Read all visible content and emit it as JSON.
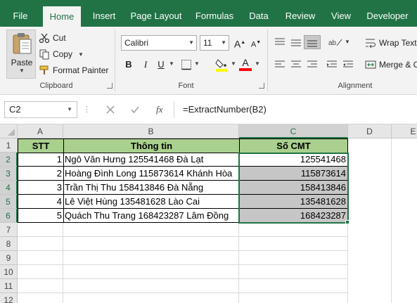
{
  "ribbon_tabs": [
    {
      "label": "File",
      "active": false
    },
    {
      "label": "Home",
      "active": true
    },
    {
      "label": "Insert",
      "active": false
    },
    {
      "label": "Page Layout",
      "active": false
    },
    {
      "label": "Formulas",
      "active": false
    },
    {
      "label": "Data",
      "active": false
    },
    {
      "label": "Review",
      "active": false
    },
    {
      "label": "View",
      "active": false
    },
    {
      "label": "Developer",
      "active": false
    }
  ],
  "clipboard": {
    "paste_label": "Paste",
    "cut_label": "Cut",
    "copy_label": "Copy",
    "format_painter_label": "Format Painter",
    "group_label": "Clipboard"
  },
  "font": {
    "font_name": "Calibri",
    "font_size": "11",
    "bold": "B",
    "italic": "I",
    "underline": "U",
    "grow": "A",
    "shrink": "A",
    "group_label": "Font"
  },
  "alignment": {
    "wrap_text_label": "Wrap Text",
    "merge_label": "Merge & C",
    "group_label": "Alignment"
  },
  "formula_bar": {
    "name_box": "C2",
    "fx": "fx",
    "formula": "=ExtractNumber(B2)"
  },
  "columns": [
    "A",
    "B",
    "C",
    "D",
    "E"
  ],
  "rows": [
    "1",
    "2",
    "3",
    "4",
    "5",
    "6",
    "7",
    "8",
    "9",
    "10",
    "11",
    "12"
  ],
  "table": {
    "headers": [
      "STT",
      "Thông tin",
      "Số CMT"
    ],
    "rows": [
      {
        "stt": "1",
        "info": "Ngô Văn Hưng 125541468 Đà Lạt",
        "cmt": "125541468"
      },
      {
        "stt": "2",
        "info": "Hoàng Đình Long 115873614 Khánh Hòa",
        "cmt": "115873614"
      },
      {
        "stt": "3",
        "info": "Trần Thị Thu 158413846 Đà Nẵng",
        "cmt": "158413846"
      },
      {
        "stt": "4",
        "info": "Lê Việt Hùng 135481628 Lào Cai",
        "cmt": "135481628"
      },
      {
        "stt": "5",
        "info": "Quách Thu Trang 168423287 Lâm Đồng",
        "cmt": "168423287"
      }
    ]
  },
  "colors": {
    "accent": "#217346",
    "header_fill": "#a9d08e",
    "selection_fill": "#c6c6c6"
  }
}
